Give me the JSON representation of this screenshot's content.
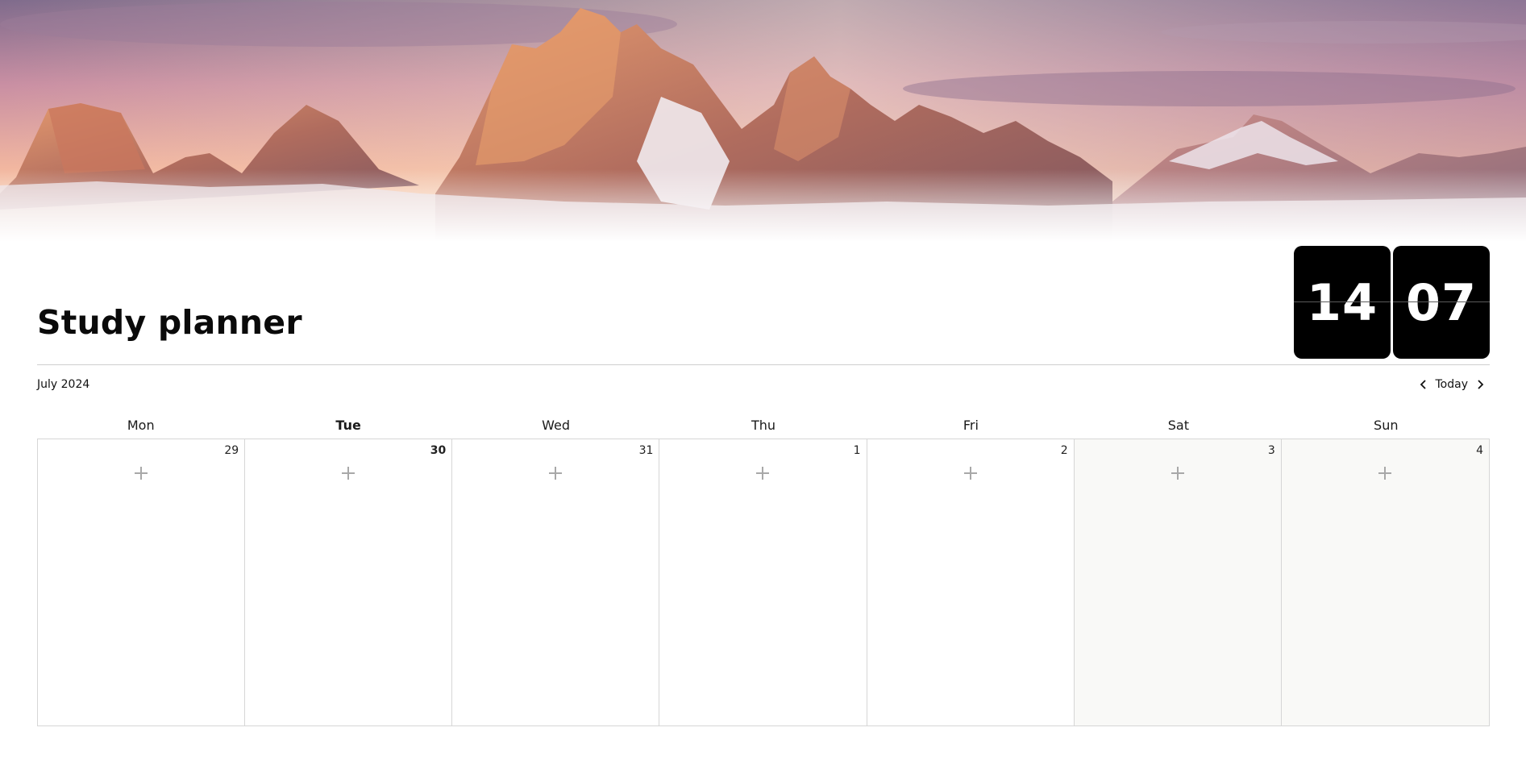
{
  "cover": {
    "image": "mountain-sunset-cover-image",
    "colors": {
      "sky_top": "#8f7a96",
      "sky_mid": "#e7a8a8",
      "sky_glow": "#f8d9a6",
      "rock_light": "#d98a6a",
      "rock_dark": "#8a5a55",
      "snow": "#ece6ea"
    }
  },
  "clock": {
    "hours": "14",
    "minutes": "07"
  },
  "page": {
    "title": "Study planner"
  },
  "calendar": {
    "month_label": "July 2024",
    "today_label": "Today",
    "prev_icon": "chevron-left-icon",
    "next_icon": "chevron-right-icon",
    "weekdays": [
      "Mon",
      "Tue",
      "Wed",
      "Thu",
      "Fri",
      "Sat",
      "Sun"
    ],
    "dates": [
      "29",
      "30",
      "31",
      "1",
      "2",
      "3",
      "4"
    ],
    "today_index": 1,
    "weekend_indices": [
      5,
      6
    ],
    "add_icon": "plus-icon"
  }
}
